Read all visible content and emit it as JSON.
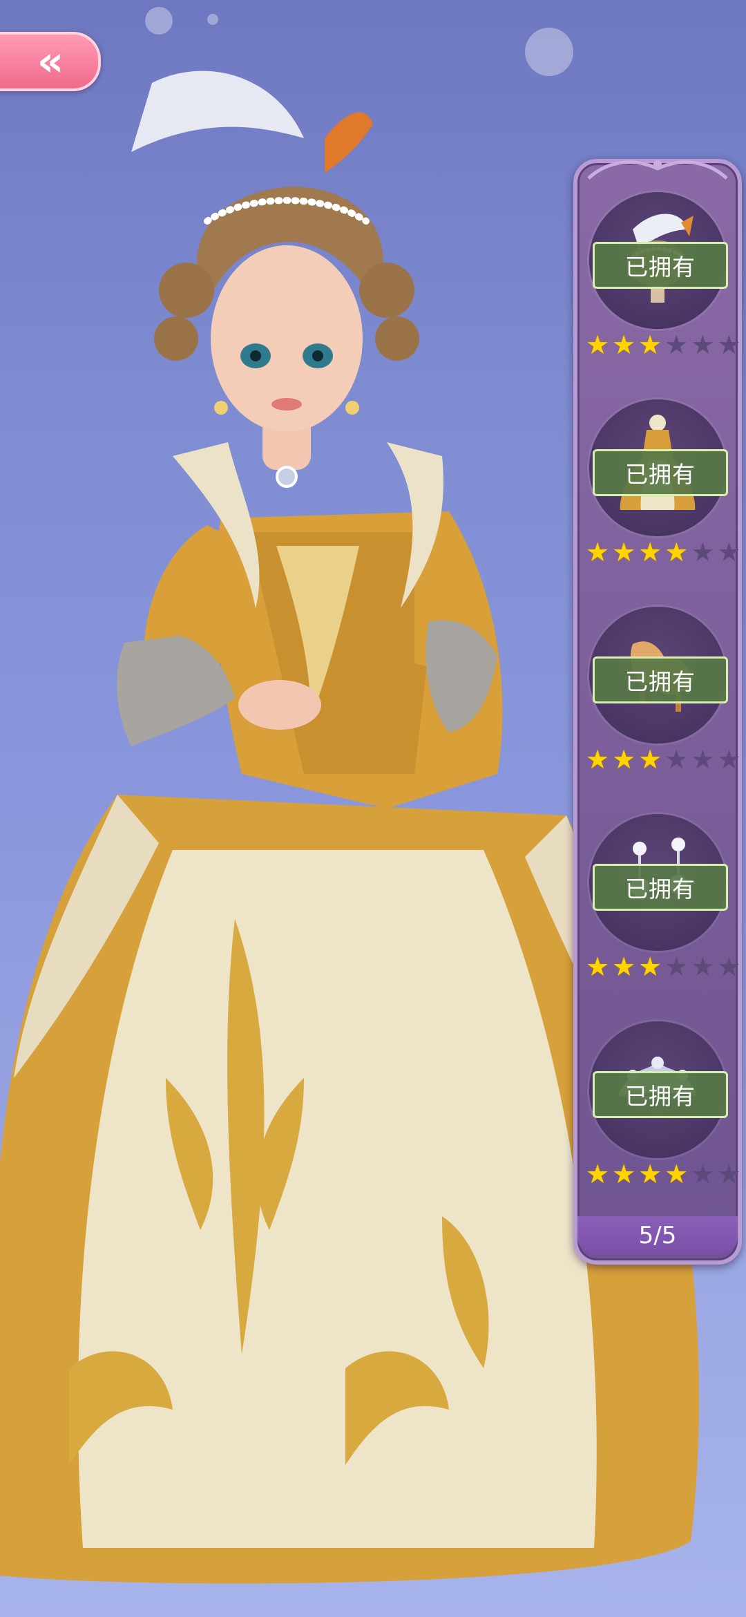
{
  "navigation": {
    "back_label": "«",
    "back_icon": "double-chevron-left-icon"
  },
  "outfit_panel": {
    "items": [
      {
        "slot": "hairstyle",
        "icon": "feather-hair-icon",
        "owned_label": "已拥有",
        "stars_filled": 3,
        "stars_total": 6
      },
      {
        "slot": "dress",
        "icon": "gown-icon",
        "owned_label": "已拥有",
        "stars_filled": 4,
        "stars_total": 6
      },
      {
        "slot": "shoes",
        "icon": "shoes-icon",
        "owned_label": "已拥有",
        "stars_filled": 3,
        "stars_total": 6
      },
      {
        "slot": "earrings",
        "icon": "pearl-earrings-icon",
        "owned_label": "已拥有",
        "stars_filled": 3,
        "stars_total": 6
      },
      {
        "slot": "accessory",
        "icon": "tiara-icon",
        "owned_label": "已拥有",
        "stars_filled": 4,
        "stars_total": 6
      }
    ],
    "page_counter": "5/5"
  },
  "colors": {
    "background": "#7f8cd2",
    "panel": "#7a5e9c",
    "owned_badge": "#587846",
    "star_on": "#ffd400",
    "star_off": "#5e4a7a",
    "back_button": "#f06a8c"
  }
}
